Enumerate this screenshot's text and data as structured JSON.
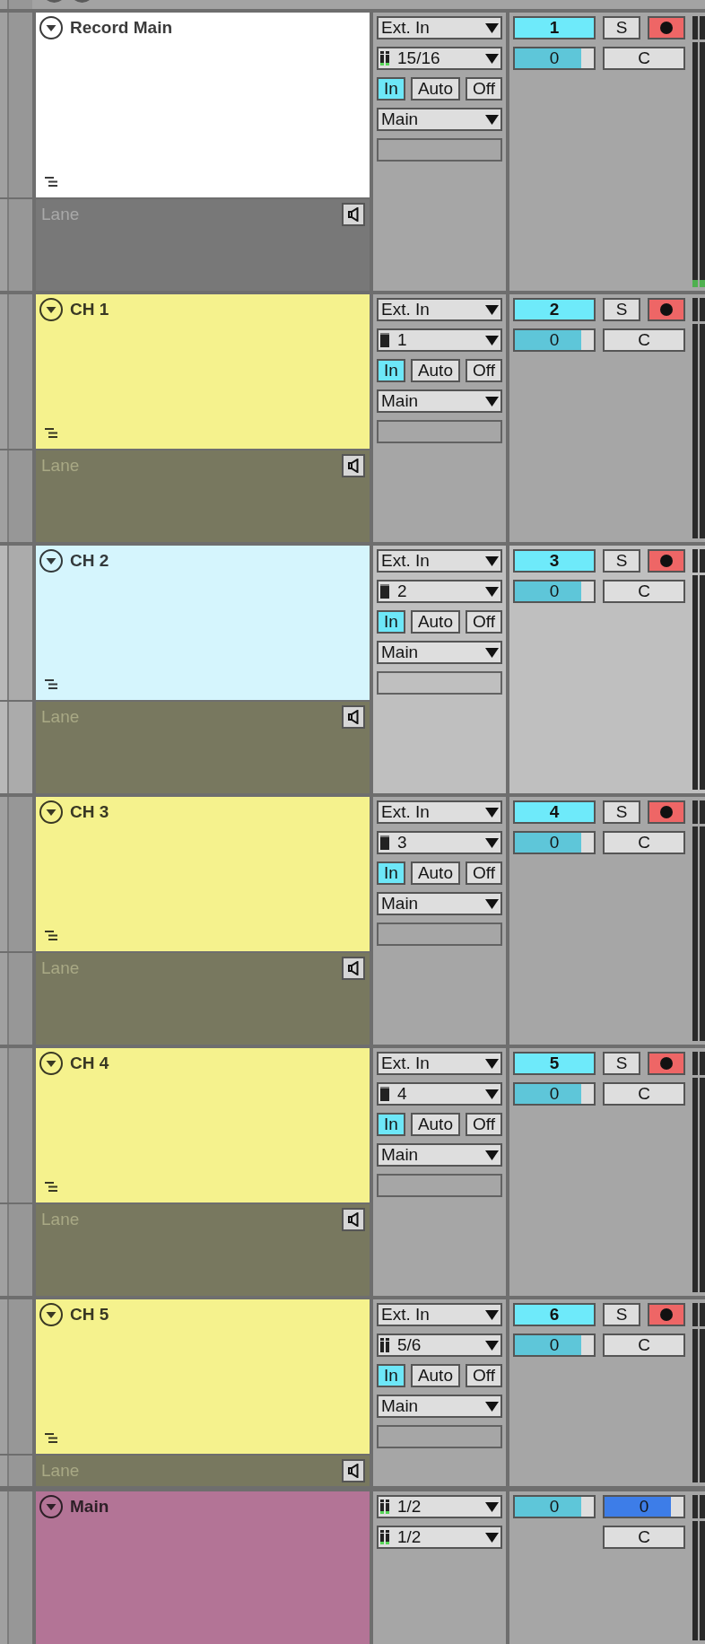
{
  "tracks": [
    {
      "name": "Record Main",
      "color": "#ffffff",
      "selected": false,
      "expanded": true,
      "lane": {
        "label": "Lane",
        "color": "#787878"
      },
      "signal": true,
      "io": [
        {
          "kind": "dropdown",
          "value": "Ext. In"
        },
        {
          "kind": "dropdown",
          "value": "15/16",
          "meter": {
            "kind": "stereo",
            "signal": true
          }
        },
        {
          "kind": "monitor",
          "options": [
            {
              "label": "In",
              "selected": true
            },
            {
              "label": "Auto",
              "selected": false
            },
            {
              "label": "Off",
              "selected": false
            }
          ]
        },
        {
          "kind": "dropdown",
          "value": "Main"
        },
        {
          "kind": "field"
        }
      ],
      "mixer": [
        [
          {
            "kind": "activator",
            "label": "1",
            "on": true
          },
          {
            "kind": "solo",
            "label": "S",
            "on": false
          },
          {
            "kind": "arm",
            "on": true
          }
        ],
        [
          {
            "kind": "volume",
            "value": "0",
            "level": 0.84
          },
          {
            "kind": "pan",
            "value": "C"
          }
        ]
      ]
    },
    {
      "name": "CH 1",
      "color": "#f5f28d",
      "selected": false,
      "expanded": true,
      "lane": {
        "label": "Lane",
        "color": "#78785f"
      },
      "signal": false,
      "io": [
        {
          "kind": "dropdown",
          "value": "Ext. In"
        },
        {
          "kind": "dropdown",
          "value": "1",
          "meter": {
            "kind": "mono",
            "signal": false
          }
        },
        {
          "kind": "monitor",
          "options": [
            {
              "label": "In",
              "selected": true
            },
            {
              "label": "Auto",
              "selected": false
            },
            {
              "label": "Off",
              "selected": false
            }
          ]
        },
        {
          "kind": "dropdown",
          "value": "Main"
        },
        {
          "kind": "field"
        }
      ],
      "mixer": [
        [
          {
            "kind": "activator",
            "label": "2",
            "on": true
          },
          {
            "kind": "solo",
            "label": "S",
            "on": false
          },
          {
            "kind": "arm",
            "on": true
          }
        ],
        [
          {
            "kind": "volume",
            "value": "0",
            "level": 0.84
          },
          {
            "kind": "pan",
            "value": "C"
          }
        ]
      ]
    },
    {
      "name": "CH 2",
      "color": "#d5f5fd",
      "selected": true,
      "expanded": true,
      "lane": {
        "label": "Lane",
        "color": "#78785f"
      },
      "signal": false,
      "io": [
        {
          "kind": "dropdown",
          "value": "Ext. In"
        },
        {
          "kind": "dropdown",
          "value": "2",
          "meter": {
            "kind": "mono",
            "signal": false
          }
        },
        {
          "kind": "monitor",
          "options": [
            {
              "label": "In",
              "selected": true
            },
            {
              "label": "Auto",
              "selected": false
            },
            {
              "label": "Off",
              "selected": false
            }
          ]
        },
        {
          "kind": "dropdown",
          "value": "Main"
        },
        {
          "kind": "field"
        }
      ],
      "mixer": [
        [
          {
            "kind": "activator",
            "label": "3",
            "on": true
          },
          {
            "kind": "solo",
            "label": "S",
            "on": false
          },
          {
            "kind": "arm",
            "on": true
          }
        ],
        [
          {
            "kind": "volume",
            "value": "0",
            "level": 0.84
          },
          {
            "kind": "pan",
            "value": "C"
          }
        ]
      ]
    },
    {
      "name": "CH 3",
      "color": "#f5f28d",
      "selected": false,
      "expanded": true,
      "lane": {
        "label": "Lane",
        "color": "#78785f"
      },
      "signal": false,
      "io": [
        {
          "kind": "dropdown",
          "value": "Ext. In"
        },
        {
          "kind": "dropdown",
          "value": "3",
          "meter": {
            "kind": "mono",
            "signal": false
          }
        },
        {
          "kind": "monitor",
          "options": [
            {
              "label": "In",
              "selected": true
            },
            {
              "label": "Auto",
              "selected": false
            },
            {
              "label": "Off",
              "selected": false
            }
          ]
        },
        {
          "kind": "dropdown",
          "value": "Main"
        },
        {
          "kind": "field"
        }
      ],
      "mixer": [
        [
          {
            "kind": "activator",
            "label": "4",
            "on": true
          },
          {
            "kind": "solo",
            "label": "S",
            "on": false
          },
          {
            "kind": "arm",
            "on": true
          }
        ],
        [
          {
            "kind": "volume",
            "value": "0",
            "level": 0.84
          },
          {
            "kind": "pan",
            "value": "C"
          }
        ]
      ]
    },
    {
      "name": "CH 4",
      "color": "#f5f28d",
      "selected": false,
      "expanded": true,
      "lane": {
        "label": "Lane",
        "color": "#78785f"
      },
      "signal": false,
      "io": [
        {
          "kind": "dropdown",
          "value": "Ext. In"
        },
        {
          "kind": "dropdown",
          "value": "4",
          "meter": {
            "kind": "mono",
            "signal": false
          }
        },
        {
          "kind": "monitor",
          "options": [
            {
              "label": "In",
              "selected": true
            },
            {
              "label": "Auto",
              "selected": false
            },
            {
              "label": "Off",
              "selected": false
            }
          ]
        },
        {
          "kind": "dropdown",
          "value": "Main"
        },
        {
          "kind": "field"
        }
      ],
      "mixer": [
        [
          {
            "kind": "activator",
            "label": "5",
            "on": true
          },
          {
            "kind": "solo",
            "label": "S",
            "on": false
          },
          {
            "kind": "arm",
            "on": true
          }
        ],
        [
          {
            "kind": "volume",
            "value": "0",
            "level": 0.84
          },
          {
            "kind": "pan",
            "value": "C"
          }
        ]
      ]
    },
    {
      "name": "CH 5",
      "color": "#f5f28d",
      "selected": false,
      "expanded": true,
      "lane": {
        "label": "Lane",
        "color": "#78785f"
      },
      "signal": false,
      "io": [
        {
          "kind": "dropdown",
          "value": "Ext. In"
        },
        {
          "kind": "dropdown",
          "value": "5/6",
          "meter": {
            "kind": "stereo",
            "signal": false
          }
        },
        {
          "kind": "monitor",
          "options": [
            {
              "label": "In",
              "selected": true
            },
            {
              "label": "Auto",
              "selected": false
            },
            {
              "label": "Off",
              "selected": false
            }
          ]
        },
        {
          "kind": "dropdown",
          "value": "Main"
        },
        {
          "kind": "field"
        }
      ],
      "mixer": [
        [
          {
            "kind": "activator",
            "label": "6",
            "on": true
          },
          {
            "kind": "solo",
            "label": "S",
            "on": false
          },
          {
            "kind": "arm",
            "on": true
          }
        ],
        [
          {
            "kind": "volume",
            "value": "0",
            "level": 0.84
          },
          {
            "kind": "pan",
            "value": "C"
          }
        ]
      ]
    },
    {
      "name": "Main",
      "color": "#b37496",
      "selected": false,
      "expanded": true,
      "signal": false,
      "io": [
        {
          "kind": "dropdown",
          "value": "1/2",
          "meter": {
            "kind": "stereo",
            "signal": true
          }
        },
        {
          "kind": "dropdown",
          "value": "1/2",
          "meter": {
            "kind": "stereo",
            "signal": true
          }
        }
      ],
      "mixer": [
        [
          {
            "kind": "volume",
            "value": "0",
            "level": 0.84
          },
          {
            "kind": "cue_volume",
            "value": "0",
            "level": 0.84
          }
        ],
        [
          {
            "kind": "pan",
            "value": "C"
          }
        ]
      ]
    }
  ]
}
